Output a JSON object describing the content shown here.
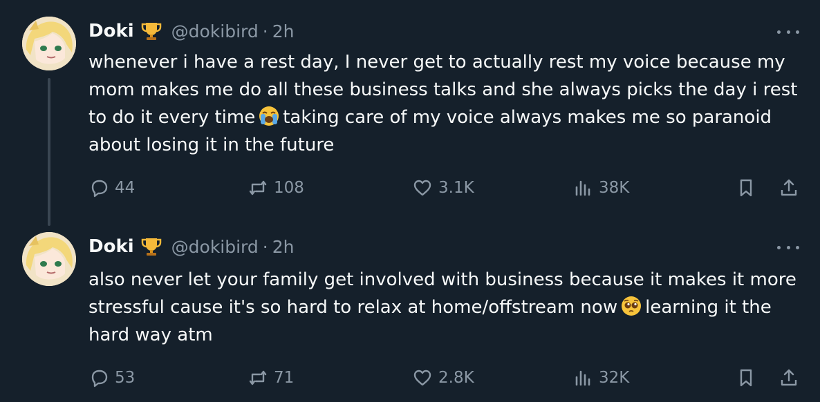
{
  "colors": {
    "background": "#15202b",
    "text": "#f7f9f9",
    "muted": "#8b98a5",
    "thread_line": "#3a4652"
  },
  "icons": {
    "reply": "speech-bubble",
    "retweet": "retweet-arrows",
    "like": "heart",
    "views": "bar-chart",
    "bookmark": "bookmark",
    "share": "share-upload",
    "more": "three-dots",
    "badge": "trophy"
  },
  "tweets": [
    {
      "author": {
        "name": "Doki",
        "handle": "@dokibird",
        "separator": "·",
        "time": "2h"
      },
      "text_part1": "whenever i have a rest day, I never get to actually rest my voice because my mom makes me do all these business talks and she always picks the day i rest to do it every time",
      "text_part2": "taking care of my voice always makes me so paranoid about losing it in the future",
      "emoji": "loudly-crying-face",
      "stats": {
        "replies": "44",
        "retweets": "108",
        "likes": "3.1K",
        "views": "38K"
      }
    },
    {
      "author": {
        "name": "Doki",
        "handle": "@dokibird",
        "separator": "·",
        "time": "2h"
      },
      "text_part1": "also never let your family get involved with business because it makes it more stressful cause it's so hard to relax at home/offstream now",
      "text_part2": "learning it the hard way atm",
      "emoji": "pleading-face",
      "stats": {
        "replies": "53",
        "retweets": "71",
        "likes": "2.8K",
        "views": "32K"
      }
    }
  ]
}
